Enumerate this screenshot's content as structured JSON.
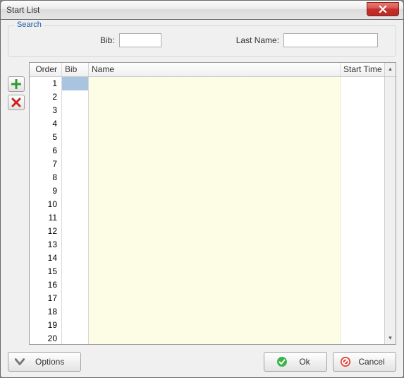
{
  "window": {
    "title": "Start List"
  },
  "search": {
    "legend": "Search",
    "bib_label": "Bib:",
    "bib_value": "",
    "lastname_label": "Last Name:",
    "lastname_value": ""
  },
  "table": {
    "columns": {
      "order": "Order",
      "bib": "Bib",
      "name": "Name",
      "start_time": "Start Time"
    },
    "rows": [
      {
        "order": "1",
        "bib": "",
        "name": "",
        "start_time": ""
      },
      {
        "order": "2",
        "bib": "",
        "name": "",
        "start_time": ""
      },
      {
        "order": "3",
        "bib": "",
        "name": "",
        "start_time": ""
      },
      {
        "order": "4",
        "bib": "",
        "name": "",
        "start_time": ""
      },
      {
        "order": "5",
        "bib": "",
        "name": "",
        "start_time": ""
      },
      {
        "order": "6",
        "bib": "",
        "name": "",
        "start_time": ""
      },
      {
        "order": "7",
        "bib": "",
        "name": "",
        "start_time": ""
      },
      {
        "order": "8",
        "bib": "",
        "name": "",
        "start_time": ""
      },
      {
        "order": "9",
        "bib": "",
        "name": "",
        "start_time": ""
      },
      {
        "order": "10",
        "bib": "",
        "name": "",
        "start_time": ""
      },
      {
        "order": "11",
        "bib": "",
        "name": "",
        "start_time": ""
      },
      {
        "order": "12",
        "bib": "",
        "name": "",
        "start_time": ""
      },
      {
        "order": "13",
        "bib": "",
        "name": "",
        "start_time": ""
      },
      {
        "order": "14",
        "bib": "",
        "name": "",
        "start_time": ""
      },
      {
        "order": "15",
        "bib": "",
        "name": "",
        "start_time": ""
      },
      {
        "order": "16",
        "bib": "",
        "name": "",
        "start_time": ""
      },
      {
        "order": "17",
        "bib": "",
        "name": "",
        "start_time": ""
      },
      {
        "order": "18",
        "bib": "",
        "name": "",
        "start_time": ""
      },
      {
        "order": "19",
        "bib": "",
        "name": "",
        "start_time": ""
      },
      {
        "order": "20",
        "bib": "",
        "name": "",
        "start_time": ""
      }
    ]
  },
  "buttons": {
    "options": "Options",
    "ok": "Ok",
    "cancel": "Cancel"
  },
  "icons": {
    "add": "plus-icon",
    "delete": "x-icon",
    "options_chevron": "chevron-down-icon",
    "ok_check": "check-circle-icon",
    "cancel_stop": "stop-circle-icon",
    "close": "close-icon"
  },
  "colors": {
    "selection": "#a9c4e0",
    "name_bg": "#fdfde6",
    "legend_color": "#1a5aa8",
    "close_red": "#c9302c",
    "ok_green": "#3bb54a",
    "cancel_red": "#e33b2e"
  }
}
